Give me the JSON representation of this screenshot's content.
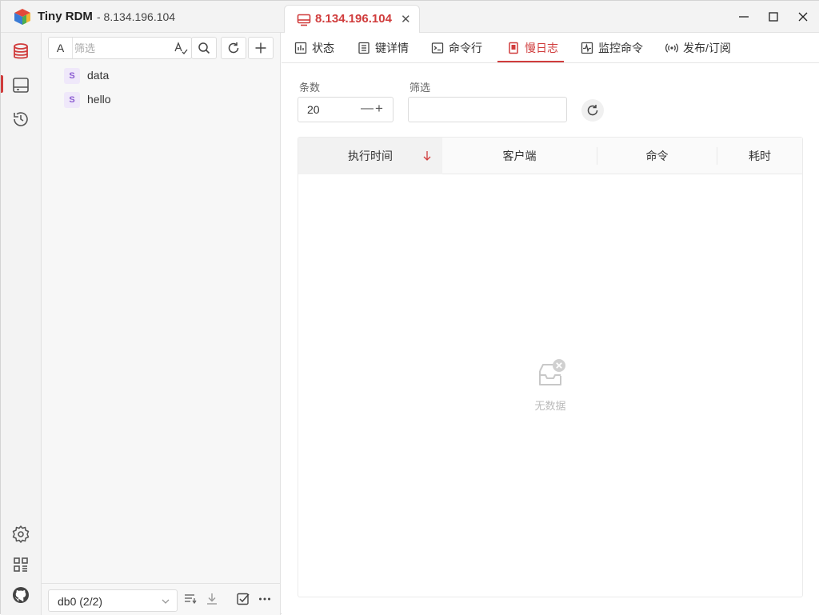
{
  "app": {
    "name": "Tiny RDM",
    "subtitle": "- 8.134.196.104"
  },
  "tab": {
    "label": "8.134.196.104"
  },
  "sidebar": {
    "filter_mode": "A",
    "filter_placeholder": "筛选",
    "keys": [
      {
        "type": "S",
        "name": "data"
      },
      {
        "type": "S",
        "name": "hello"
      }
    ],
    "db_label": "db0 (2/2)"
  },
  "subtabs": [
    "状态",
    "键详情",
    "命令行",
    "慢日志",
    "监控命令",
    "发布/订阅"
  ],
  "active_subtab": "慢日志",
  "slowlog": {
    "count_label": "条数",
    "count_value": "20",
    "filter_label": "筛选",
    "filter_value": "",
    "columns": [
      "执行时间",
      "客户端",
      "命令",
      "耗时"
    ],
    "empty_text": "无数据"
  },
  "colors": {
    "accent": "#d03c3c",
    "key_badge": "#8a5ad1"
  }
}
